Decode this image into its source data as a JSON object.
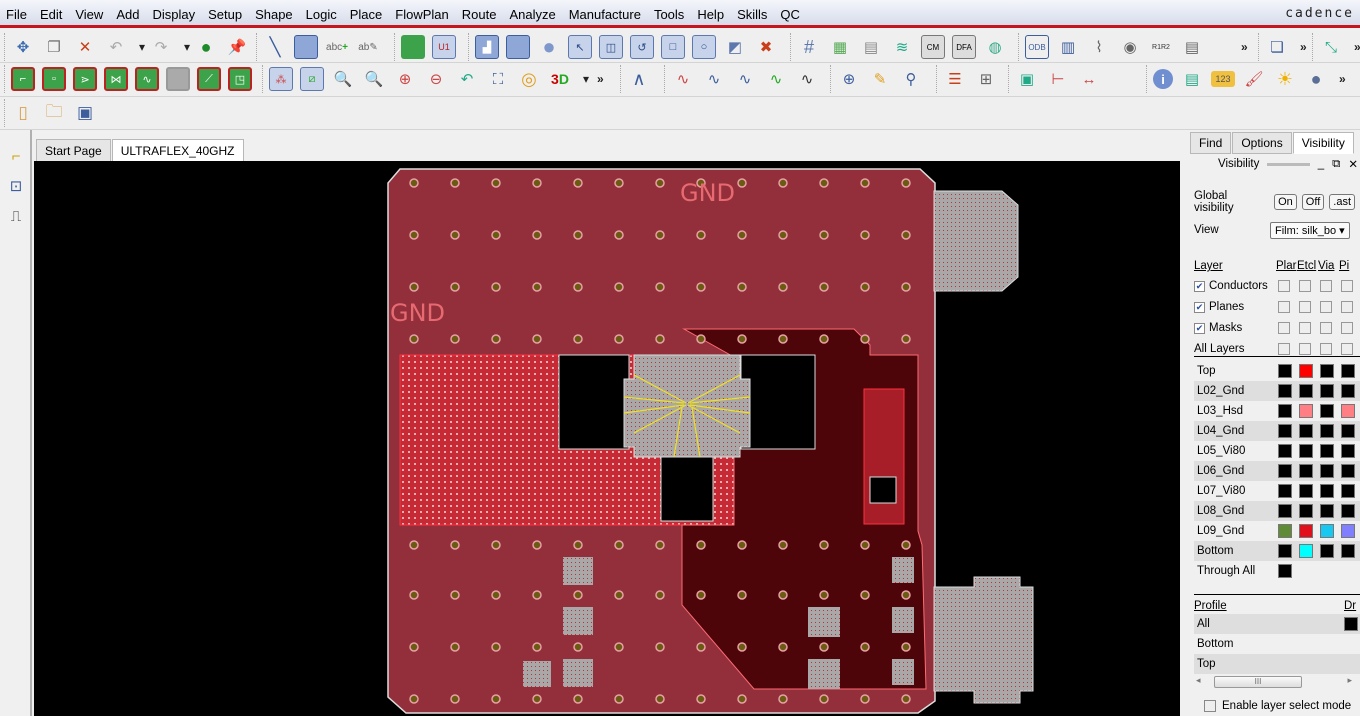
{
  "menubar": {
    "items": [
      "File",
      "Edit",
      "View",
      "Add",
      "Display",
      "Setup",
      "Shape",
      "Logic",
      "Place",
      "FlowPlan",
      "Route",
      "Analyze",
      "Manufacture",
      "Tools",
      "Help",
      "Skills",
      "QC"
    ],
    "brand": "cadence"
  },
  "toolbar": {
    "row1": [
      "move",
      "copy",
      "delete",
      "undo",
      "redo",
      "pin-fix",
      "unpin",
      "add-line",
      "add-rect",
      "add-text",
      "edit-text",
      "place-manual",
      "component",
      "shape-poly",
      "shape-rect",
      "shape-circle",
      "select-shape",
      "merge-shapes",
      "void",
      "shape-edit",
      "void-circle",
      "manual-void",
      "delete-islands",
      "grid",
      "color",
      "layer-priority",
      "cross-section",
      "constraint-manager",
      "dfa",
      "3d-globe",
      "odb-export",
      "artwork",
      "drill",
      "snapshot",
      "rename",
      "report",
      "more",
      "spreadsheet",
      "more",
      "flow",
      "more"
    ],
    "row2": [
      "etch-route",
      "pin-swap",
      "slide",
      "add-connect",
      "delay-tune",
      "disabled",
      "custom-smooth",
      "cline-edit",
      "unrats",
      "rats",
      "zoom-fit",
      "zoom-world",
      "zoom-in",
      "zoom-out",
      "zoom-previous",
      "zoom-select",
      "refresh",
      "3d-view",
      "more",
      "spline",
      "route-1",
      "route-2",
      "route-3",
      "route-4",
      "route-5",
      "via-add",
      "via-edit",
      "via-replace",
      "ratsnest-list",
      "add-ratsnest",
      "placement",
      "dimension-1",
      "dimension-2",
      "show-element",
      "info",
      "measure",
      "highlight",
      "dehighlight",
      "assign-color",
      "more"
    ],
    "row3": [
      "new-file",
      "open-file",
      "save-file"
    ]
  },
  "tabs": [
    {
      "label": "Start Page",
      "active": false
    },
    {
      "label": "ULTRAFLEX_40GHZ",
      "active": true
    }
  ],
  "canvas": {
    "labels": [
      "GND",
      "GND"
    ]
  },
  "panel": {
    "tabs": [
      {
        "label": "Find",
        "active": false
      },
      {
        "label": "Options",
        "active": false
      },
      {
        "label": "Visibility",
        "active": true
      }
    ],
    "title": "Visibility",
    "global_visibility_label": "Global visibility",
    "global_buttons": [
      "On",
      "Off",
      "Last"
    ],
    "global_buttons_shown": [
      "On",
      "Off",
      ".ast"
    ],
    "view_label": "View",
    "view_value": "Film: silk_bot",
    "view_value_shown": "Film: silk_bo",
    "layer_header": "Layer",
    "column_headers": [
      "Plan",
      "Etch",
      "Via",
      "Pin"
    ],
    "column_headers_shown": [
      "Plar",
      "Etcl",
      "Via",
      "Pi"
    ],
    "groups": [
      {
        "label": "Conductors",
        "checked": true
      },
      {
        "label": "Planes",
        "checked": true
      },
      {
        "label": "Masks",
        "checked": true
      },
      {
        "label": "All Layers",
        "checked": null
      }
    ],
    "layers": [
      {
        "name": "Top",
        "colors": [
          "#000000",
          "#ff0000",
          "#000000",
          "#000000"
        ]
      },
      {
        "name": "L02_Gnd",
        "colors": [
          "#000000",
          "#000000",
          "#000000",
          "#000000"
        ]
      },
      {
        "name": "L03_Hsd",
        "colors": [
          "#000000",
          "#ff7f85",
          "#000000",
          "#ff7f85"
        ]
      },
      {
        "name": "L04_Gnd",
        "colors": [
          "#000000",
          "#000000",
          "#000000",
          "#000000"
        ]
      },
      {
        "name": "L05_Vi80",
        "colors": [
          "#000000",
          "#000000",
          "#000000",
          "#000000"
        ]
      },
      {
        "name": "L06_Gnd",
        "colors": [
          "#000000",
          "#000000",
          "#000000",
          "#000000"
        ]
      },
      {
        "name": "L07_Vi80",
        "colors": [
          "#000000",
          "#000000",
          "#000000",
          "#000000"
        ]
      },
      {
        "name": "L08_Gnd",
        "colors": [
          "#000000",
          "#000000",
          "#000000",
          "#000000"
        ]
      },
      {
        "name": "L09_Gnd",
        "colors": [
          "#5f8a36",
          "#e0101c",
          "#18c8f0",
          "#8080ff"
        ]
      },
      {
        "name": "Bottom",
        "colors": [
          "#000000",
          "#00ffff",
          "#000000",
          "#000000"
        ]
      },
      {
        "name": "Through All",
        "colors": [
          "#000000"
        ]
      }
    ],
    "profile_header": "Profile",
    "profile_col_header": "Dr",
    "profiles": [
      "All",
      "Bottom",
      "Top"
    ],
    "enable_layer_select_label": "Enable layer select mode",
    "enable_layer_select_checked": false
  }
}
